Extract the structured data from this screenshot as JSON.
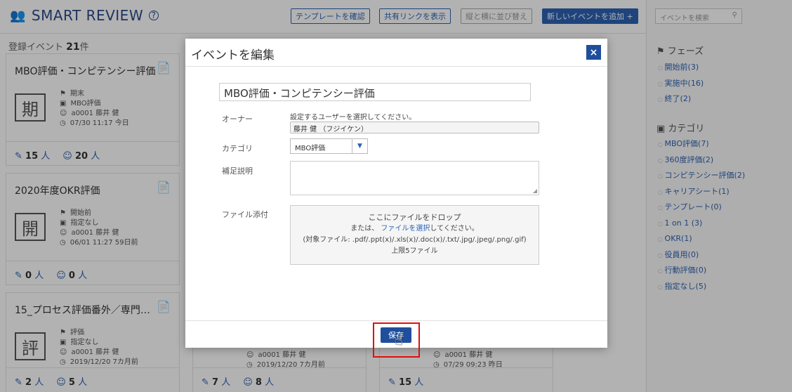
{
  "header": {
    "brand": "SMART REVIEW",
    "help": "?",
    "buttons": {
      "template": "テンプレートを確認",
      "share": "共有リンクを表示",
      "sort": "縦と横に並び替え",
      "add": "新しいイベントを追加 +"
    }
  },
  "summary": {
    "label": "登録イベント",
    "count": "21",
    "unit": "件"
  },
  "cards": [
    {
      "title": "MBO評価・コンピテンシー評価",
      "kanji": "期",
      "phase": "期末",
      "category": "MBO評価",
      "owner": "a0001 藤井 健",
      "date": "07/30 11:17 今日",
      "c1": "15",
      "c2": "20",
      "unit": "人"
    },
    {
      "title": "2020年度OKR評価",
      "kanji": "開",
      "phase": "開始前",
      "category": "指定なし",
      "owner": "a0001 藤井 健",
      "date": "06/01 11:27 59日前",
      "c1": "0",
      "c2": "0",
      "unit": "人"
    },
    {
      "title": "15_プロセス評価番外／専門…",
      "kanji": "評",
      "phase": "評価",
      "category": "指定なし",
      "owner": "a0001 藤井 健",
      "date": "2019/12/20 7カ月前",
      "c1": "2",
      "c2": "5",
      "unit": "人"
    },
    {
      "owner": "a0001 藤井 健",
      "date": "2019/12/20 7カ月前",
      "c1": "7",
      "c2": "8",
      "unit": "人"
    },
    {
      "owner": "a0001 藤井 健",
      "date": "07/29 09:23 昨日",
      "c1": "15",
      "unit": "人"
    }
  ],
  "sidebar": {
    "search_placeholder": "イベントを検索",
    "phase_head": "フェーズ",
    "phases": [
      "開始前(3)",
      "実施中(16)",
      "終了(2)"
    ],
    "category_head": "カテゴリ",
    "categories": [
      "MBO評価(7)",
      "360度評価(2)",
      "コンピテンシー評価(2)",
      "キャリアシート(1)",
      "テンプレート(0)",
      "1 on 1 (3)",
      "OKR(1)",
      "役員用(0)",
      "行動評価(0)",
      "指定なし(5)"
    ]
  },
  "modal": {
    "title": "イベントを編集",
    "close": "×",
    "event_name": "MBO評価・コンピテンシー評価",
    "owner_label": "オーナー",
    "owner_hint": "設定するユーザーを選択してください。",
    "owner_value": "藤井 健 （フジイケン）",
    "category_label": "カテゴリ",
    "category_value": "MBO評価",
    "description_label": "補足説明",
    "file_label": "ファイル添付",
    "drop_main": "ここにファイルをドロップ",
    "drop_or": "または、",
    "drop_link": "ファイルを選択",
    "drop_after": "してください。",
    "drop_types": "(対象ファイル: .pdf/.ppt(x)/.xls(x)/.doc(x)/.txt/.jpg/.jpeg/.png/.gif)",
    "drop_limit": "上限5ファイル",
    "save": "保存"
  }
}
